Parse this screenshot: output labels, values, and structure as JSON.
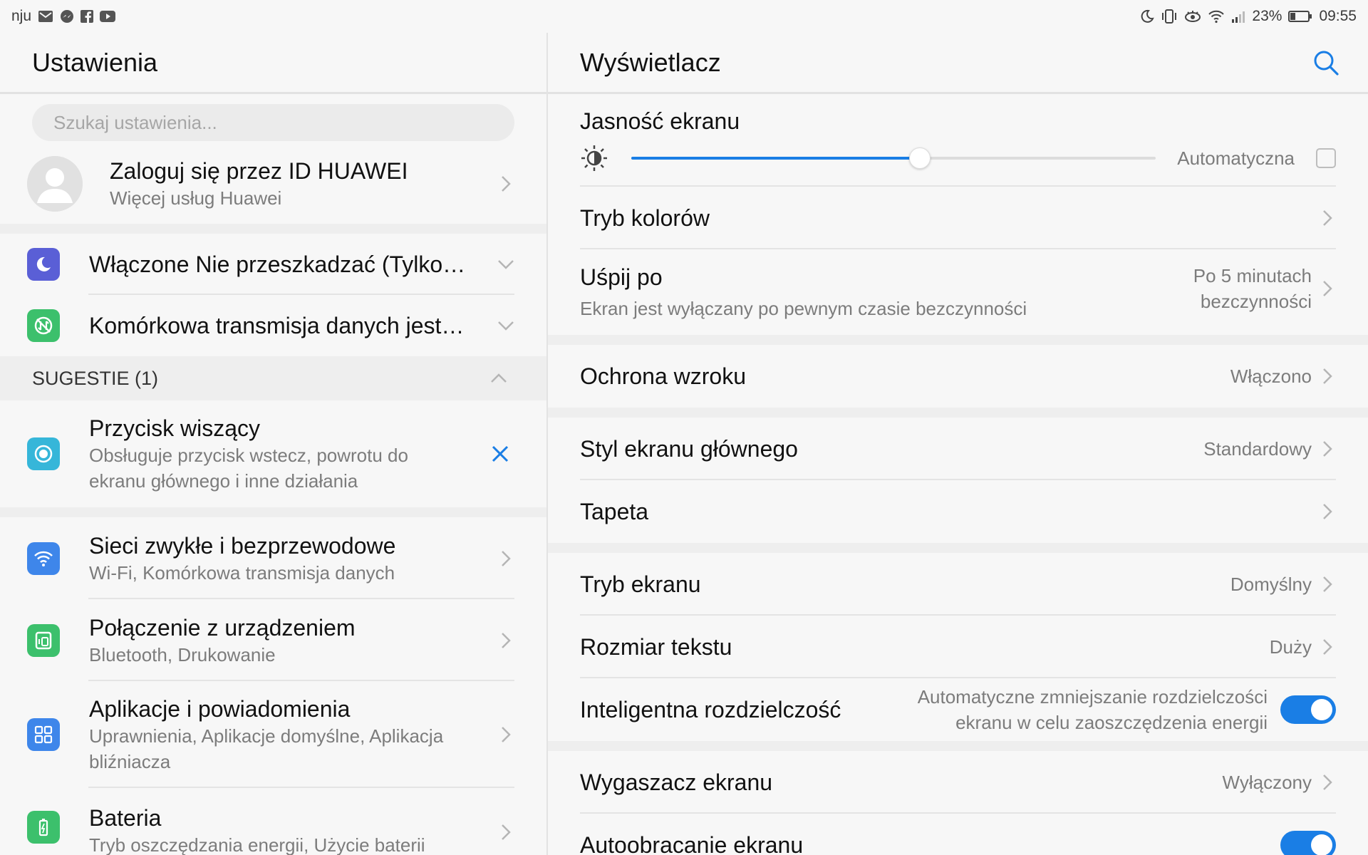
{
  "status_bar": {
    "carrier": "nju",
    "battery": "23%",
    "time": "09:55",
    "left_icons": [
      "gmail-icon",
      "messenger-icon",
      "facebook-icon",
      "youtube-icon"
    ],
    "right_icons": [
      "moon-icon",
      "vibrate-icon",
      "eye-comfort-icon",
      "wifi-icon",
      "signal-icon",
      "battery-icon"
    ]
  },
  "left": {
    "title": "Ustawienia",
    "search_placeholder": "Szukaj ustawienia...",
    "account": {
      "title": "Zaloguj się przez ID HUAWEI",
      "subtitle": "Więcej usług Huawei"
    },
    "status_items": [
      {
        "label": "Włączone Nie przeszkadzać (Tylko…",
        "icon": "moon-icon",
        "color": "#5a5fd6"
      },
      {
        "label": "Komórkowa transmisja danych jest…",
        "icon": "mobile-data-off-icon",
        "color": "#3cc06c"
      }
    ],
    "suggestions": {
      "header": "SUGESTIE (1)",
      "item": {
        "title": "Przycisk wiszący",
        "subtitle": "Obsługuje przycisk wstecz, powrotu do ekranu głównego i inne działania",
        "color": "#36b6d9"
      }
    },
    "menu": [
      {
        "title": "Sieci zwykłe i bezprzewodowe",
        "subtitle": "Wi-Fi, Komórkowa transmisja danych",
        "icon": "wifi-icon",
        "color": "#3e86ea"
      },
      {
        "title": "Połączenie z urządzeniem",
        "subtitle": "Bluetooth, Drukowanie",
        "icon": "device-connection-icon",
        "color": "#3cc06c"
      },
      {
        "title": "Aplikacje i powiadomienia",
        "subtitle": "Uprawnienia, Aplikacje domyślne, Aplikacja bliźniacza",
        "icon": "apps-grid-icon",
        "color": "#3e86ea"
      },
      {
        "title": "Bateria",
        "subtitle": "Tryb oszczędzania energii, Użycie baterii",
        "icon": "battery-icon",
        "color": "#3cc06c"
      }
    ]
  },
  "right": {
    "title": "Wyświetlacz",
    "brightness": {
      "title": "Jasność ekranu",
      "auto_label": "Automatyczna",
      "level_percent": 55,
      "auto_checked": false
    },
    "rows": [
      {
        "title": "Tryb kolorów"
      },
      {
        "title": "Uśpij po",
        "subtitle": "Ekran jest wyłączany po pewnym czasie bezczynności",
        "value_line1": "Po 5 minutach",
        "value_line2": "bezczynności"
      },
      {
        "title": "Ochrona wzroku",
        "value": "Włączono"
      },
      {
        "title": "Styl ekranu głównego",
        "value": "Standardowy"
      },
      {
        "title": "Tapeta"
      },
      {
        "title": "Tryb ekranu",
        "value": "Domyślny"
      },
      {
        "title": "Rozmiar tekstu",
        "value": "Duży"
      },
      {
        "title": "Inteligentna rozdzielczość",
        "value_line1": "Automatyczne zmniejszanie rozdzielczości",
        "value_line2": "ekranu w celu zaoszczędzenia energii",
        "toggle_on": true
      },
      {
        "title": "Wygaszacz ekranu",
        "value": "Wyłączony"
      },
      {
        "title": "Autoobracanie ekranu",
        "toggle_on": true
      }
    ]
  },
  "colors": {
    "accent": "#1a7ee5",
    "chevron": "#b5b5b5",
    "section_bg": "#eeeeee"
  }
}
